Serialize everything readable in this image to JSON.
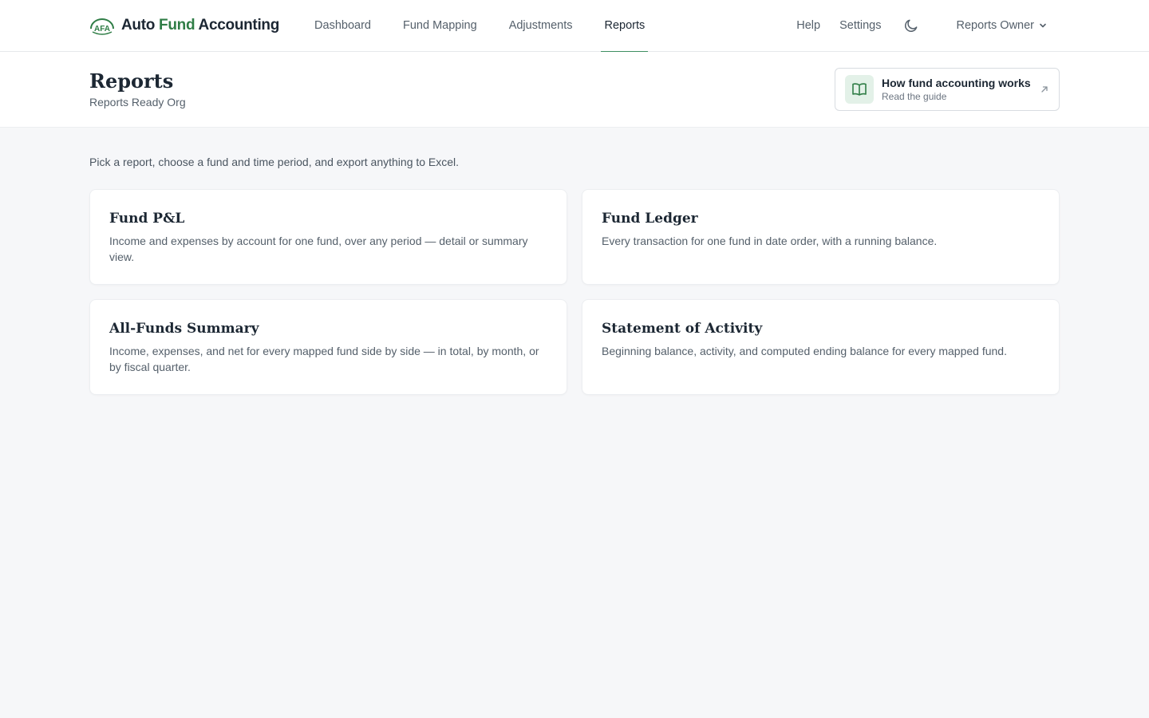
{
  "app": {
    "logo_mark": "AFA",
    "name_part1": "Auto ",
    "name_accent": "Fund",
    "name_part2": " Accounting"
  },
  "nav": {
    "items": [
      {
        "label": "Dashboard",
        "active": false
      },
      {
        "label": "Fund Mapping",
        "active": false
      },
      {
        "label": "Adjustments",
        "active": false
      },
      {
        "label": "Reports",
        "active": true
      }
    ]
  },
  "topright": {
    "help_label": "Help",
    "settings_label": "Settings",
    "theme_icon": "moon-icon",
    "user_label": "Reports Owner"
  },
  "header": {
    "title": "Reports",
    "subtitle": "Reports Ready Org",
    "guide_title": "How fund accounting works",
    "guide_sub": "Read the guide"
  },
  "main": {
    "intro": "Pick a report, choose a fund and time period, and export anything to Excel.",
    "cards": [
      {
        "title": "Fund P&L",
        "desc": "Income and expenses by account for one fund, over any period — detail or summary view."
      },
      {
        "title": "Fund Ledger",
        "desc": "Every transaction for one fund in date order, with a running balance."
      },
      {
        "title": "All-Funds Summary",
        "desc": "Income, expenses, and net for every mapped fund side by side — in total, by month, or by fiscal quarter."
      },
      {
        "title": "Statement of Activity",
        "desc": "Beginning balance, activity, and computed ending balance for every mapped fund."
      }
    ]
  },
  "colors": {
    "accent": "#2f7d46",
    "active_underline": "#3f8f62",
    "page_bg": "#f6f7f9"
  }
}
